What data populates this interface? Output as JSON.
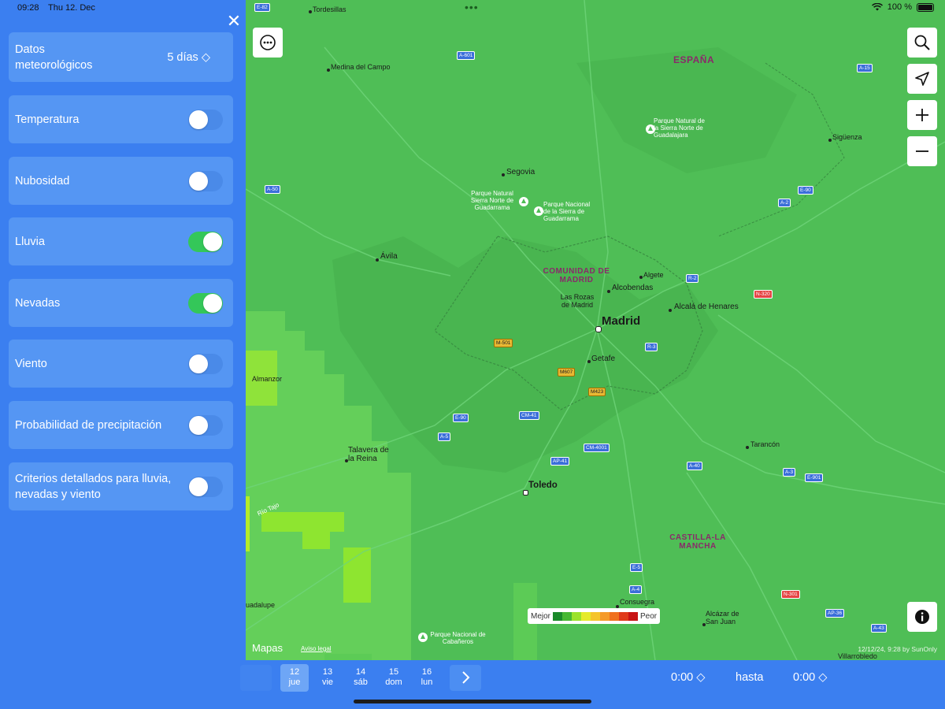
{
  "status": {
    "time": "09:28",
    "date": "Thu 12. Dec",
    "battery": "100 %"
  },
  "sidebar": {
    "weather_data": {
      "label": "Datos meteorológicos",
      "value": "5 días ◇"
    },
    "items": [
      {
        "label": "Temperatura",
        "on": false
      },
      {
        "label": "Nubosidad",
        "on": false
      },
      {
        "label": "Lluvia",
        "on": true
      },
      {
        "label": "Nevadas",
        "on": true
      },
      {
        "label": "Viento",
        "on": false
      },
      {
        "label": "Probabilidad de precipitación",
        "on": false
      },
      {
        "label": "Criterios detallados para lluvia, nevadas y viento",
        "on": false
      }
    ]
  },
  "map": {
    "cities": {
      "madrid": "Madrid",
      "toledo": "Toledo",
      "segovia": "Segovia",
      "avila": "Ávila",
      "alcobendas": "Alcobendas",
      "las_rozas": "Las Rozas de Madrid",
      "algete": "Algete",
      "alcala": "Alcalá de Henares",
      "getafe": "Getafe",
      "talavera": "Talavera de la Reina",
      "tarancon": "Tarancón",
      "consuegra": "Consuegra",
      "alcazar": "Alcázar de San Juan",
      "villarrobledo": "Villarrobledo",
      "medina": "Medina del Campo",
      "tordesillas": "Tordesillas",
      "siguenza": "Sigüenza",
      "almanzor": "Almanzor",
      "guadalupe": "uadalupe",
      "rio_tajo": "Río Tajo"
    },
    "regions": {
      "espana": "ESPAÑA",
      "comunidad": "COMUNIDAD DE MADRID",
      "castilla": "CASTILLA-LA MANCHA"
    },
    "parks": {
      "sierra_norte_gdl": "Parque Natural de la Sierra Norte de Guadalajara",
      "sierra_norte_gdr": "Parque Natural Sierra Norte de Guadarrama",
      "sierra_gdr": "Parque Nacional de la Sierra de Guadarrama",
      "cabaneros": "Parque Nacional de Cabañeros"
    },
    "roads": [
      "E-82",
      "A-601",
      "A-50",
      "A-15",
      "E-90",
      "A-2",
      "N-320",
      "M-501",
      "M607",
      "M423",
      "R-3",
      "R-2",
      "E-90",
      "A-5",
      "CM-41",
      "CM-4001",
      "AP-41",
      "A-40",
      "A-3",
      "E-901",
      "E-5",
      "A-4",
      "N-301",
      "AP-36",
      "A-43"
    ],
    "legend": {
      "best": "Mejor",
      "worst": "Peor",
      "colors": [
        "#1a8a2a",
        "#46b832",
        "#9be22a",
        "#e6ea2a",
        "#f5c42a",
        "#f59a2a",
        "#f0701e",
        "#e03a1a",
        "#c81414"
      ]
    },
    "maps_logo": "Mapas",
    "legal": "Aviso legal",
    "stamp": "12/12/24, 9:28 by SunOnly"
  },
  "days": [
    {
      "num": "12",
      "name": "jue",
      "selected": true
    },
    {
      "num": "13",
      "name": "vie",
      "selected": false
    },
    {
      "num": "14",
      "name": "sáb",
      "selected": false
    },
    {
      "num": "15",
      "name": "dom",
      "selected": false
    },
    {
      "num": "16",
      "name": "lun",
      "selected": false
    }
  ],
  "time": {
    "from": "0:00 ◇",
    "until": "hasta",
    "to": "0:00 ◇"
  }
}
